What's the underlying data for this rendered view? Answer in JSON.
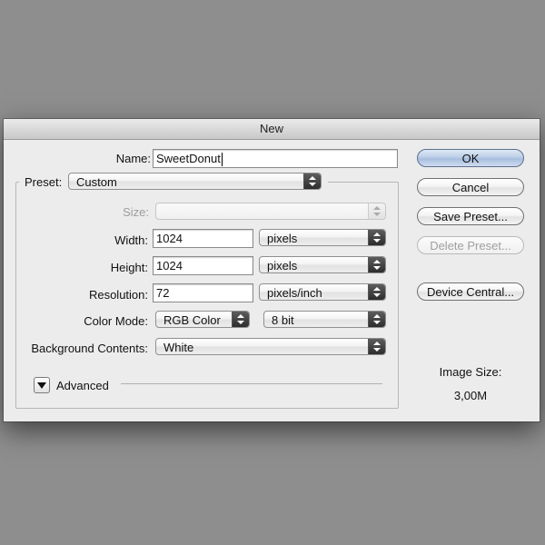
{
  "dialog": {
    "title": "New"
  },
  "name": {
    "label": "Name:",
    "value": "SweetDonut"
  },
  "preset": {
    "label": "Preset:",
    "value": "Custom"
  },
  "size": {
    "label": "Size:",
    "value": ""
  },
  "width": {
    "label": "Width:",
    "value": "1024",
    "unit": "pixels"
  },
  "height": {
    "label": "Height:",
    "value": "1024",
    "unit": "pixels"
  },
  "resolution": {
    "label": "Resolution:",
    "value": "72",
    "unit": "pixels/inch"
  },
  "color_mode": {
    "label": "Color Mode:",
    "value": "RGB Color",
    "bits": "8 bit"
  },
  "background": {
    "label": "Background Contents:",
    "value": "White"
  },
  "advanced": {
    "label": "Advanced"
  },
  "buttons": {
    "ok": "OK",
    "cancel": "Cancel",
    "save_preset": "Save Preset...",
    "delete_preset": "Delete Preset...",
    "device_central": "Device Central..."
  },
  "image_size": {
    "label": "Image Size:",
    "value": "3,00M"
  },
  "colors": {
    "default_button": "#b7cae4",
    "desktop": "#8e8e8e",
    "dialog": "#ececec"
  }
}
